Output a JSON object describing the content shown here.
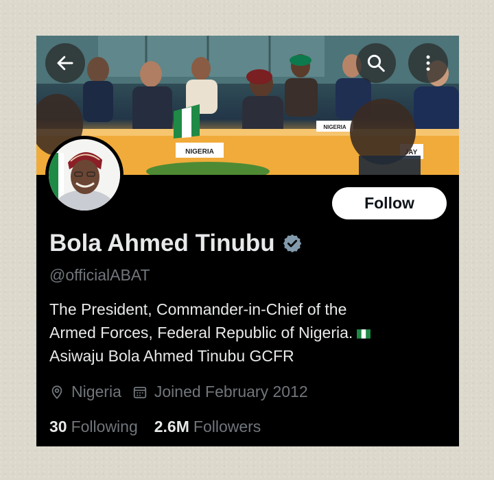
{
  "profile": {
    "display_name": "Bola Ahmed Tinubu",
    "handle": "@officialABAT",
    "bio_lines": [
      "The President, Commander-in-Chief of the",
      "Armed Forces, Federal Republic of Nigeria.",
      "Asiwaju Bola Ahmed Tinubu GCFR"
    ],
    "location": "Nigeria",
    "joined": "Joined February 2012",
    "following_count": "30",
    "following_label": "Following",
    "followers_count": "2.6M",
    "followers_label": "Followers",
    "verified_badge": "verified-badge-icon"
  },
  "banner": {
    "placards": [
      "NIGERIA",
      "NIGERIA",
      "JAY"
    ]
  },
  "actions": {
    "follow_label": "Follow",
    "back_icon": "arrow-left-icon",
    "search_icon": "search-icon",
    "more_icon": "more-vertical-icon"
  },
  "colors": {
    "background": "#000000",
    "text_primary": "#e7e9ea",
    "text_secondary": "#71767b",
    "follow_button_bg": "#ffffff",
    "verified_badge": "#829aab"
  }
}
